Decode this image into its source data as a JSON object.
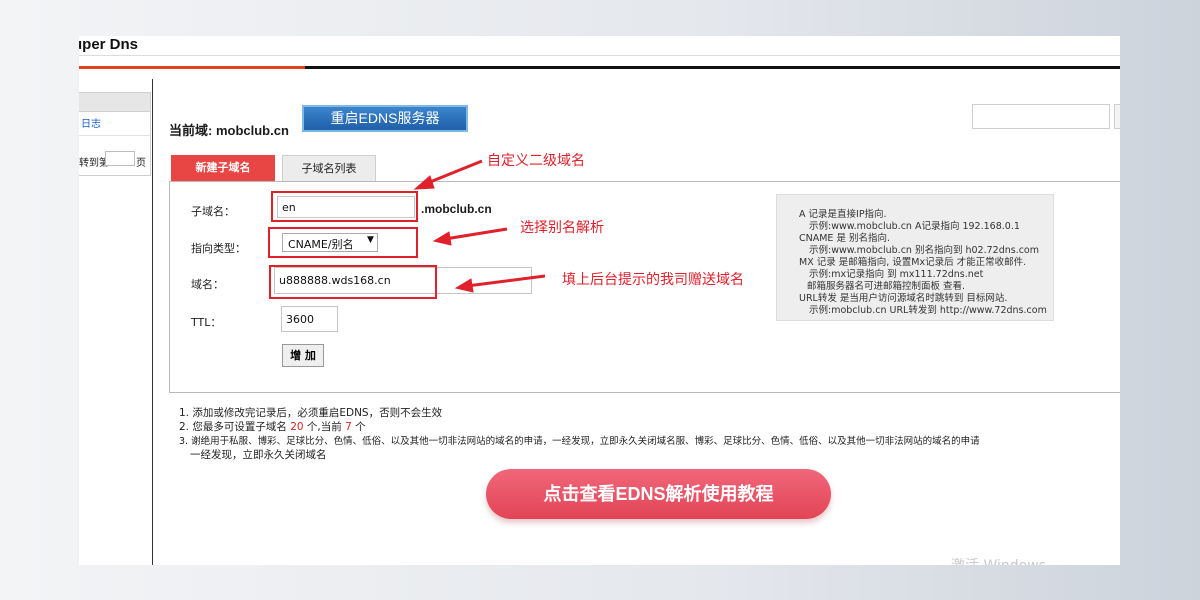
{
  "app": {
    "logo_text": "uper Dns"
  },
  "sidebar": {
    "log_link": "日志",
    "jump_prefix": "转到第",
    "jump_suffix": "页"
  },
  "header": {
    "current_domain_label": "当前域: mobclub.cn",
    "restart_button": "重启EDNS服务器"
  },
  "tabs": [
    {
      "label": "新建子域名",
      "active": true
    },
    {
      "label": "子域名列表",
      "active": false
    }
  ],
  "form": {
    "subdomain_label": "子域名：",
    "subdomain_value": "en",
    "domain_suffix": ".mobclub.cn",
    "type_label": "指向类型：",
    "type_value": "CNAME/别名",
    "target_label": "域名：",
    "target_value": "u888888.wds168.cn",
    "ttl_label": "TTL：",
    "ttl_value": "3600",
    "add_button": "增 加"
  },
  "annotations": {
    "subdomain": "自定义二级域名",
    "type": "选择别名解析",
    "target": "填上后台提示的我司赠送域名",
    "color": "#e0202a"
  },
  "info_box": {
    "lines": [
      "A 记录是直接IP指向.",
      "示例:www.mobclub.cn A记录指向 192.168.0.1",
      "CNAME 是 别名指向.",
      "示例:www.mobclub.cn 别名指向到 h02.72dns.com",
      "MX 记录 是邮箱指向, 设置Mx记录后 才能正常收邮件.",
      "示例:mx记录指向 到 mx111.72dns.net",
      "邮箱服务器名可进邮箱控制面板 查看.",
      "URL转发 是当用户访问源域名时跳转到 目标网站.",
      "示例:mobclub.cn URL转发到 http://www.72dns.com"
    ]
  },
  "notes": {
    "note1": "1. 添加或修改完记录后，必须重启EDNS，否则不会生效",
    "note2_prefix": "2. 您最多可设置子域名 ",
    "note2_max": "20",
    "note2_middle": " 个,当前 ",
    "note2_current": "7",
    "note2_suffix": " 个",
    "note3_line1": "3. 谢绝用于私服、博彩、足球比分、色情、低俗、以及其他一切非法网站的域名的申请，一经发现，立即永久关闭域名服、博彩、足球比分、色情、低俗、以及其他一切非法网站的域名的申请",
    "note3_line2": "一经发现，立即永久关闭域名"
  },
  "tutorial_button": "点击查看EDNS解析使用教程",
  "watermark": "激活 Windows",
  "colors": {
    "accent_red": "#e84545",
    "brand_blue": "#2a6fba",
    "topbar_orange": "#e2431d"
  }
}
